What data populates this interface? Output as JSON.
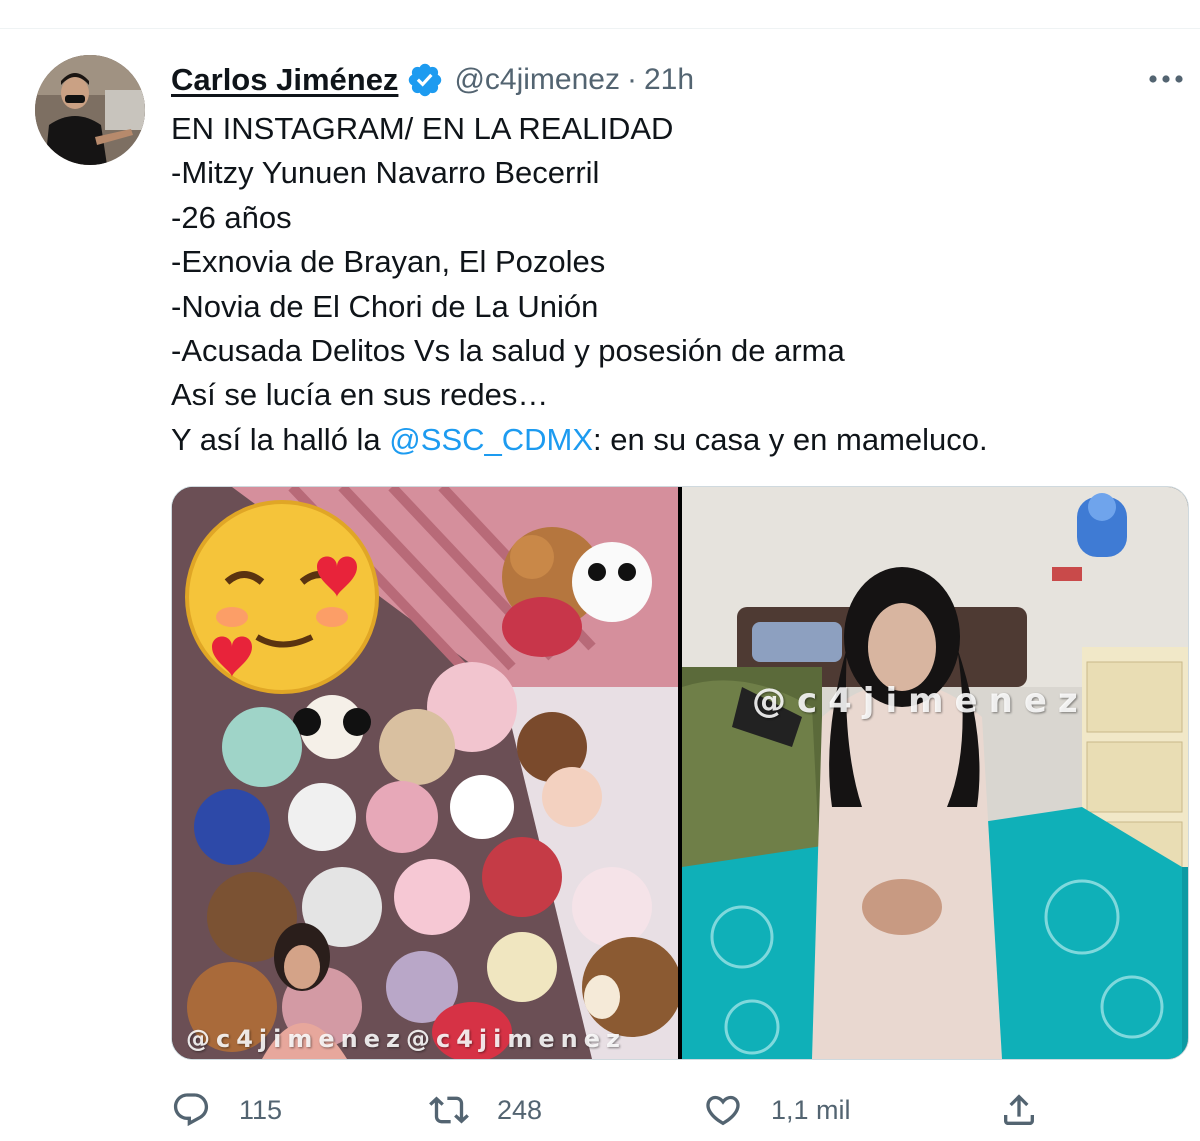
{
  "tweet": {
    "author": {
      "display_name": "Carlos Jiménez",
      "handle": "@c4jimenez",
      "verified": true,
      "avatar_icon": "avatar-photo"
    },
    "separator": "·",
    "time": "21h",
    "text_lines": [
      "EN INSTAGRAM/ EN LA REALIDAD",
      "-Mitzy Yunuen Navarro Becerril",
      "-26 años",
      "-Exnovia de Brayan, El Pozoles",
      "-Novia de El Chori de La Unión",
      "-Acusada Delitos Vs la salud y posesión de arma",
      "Así se lucía en sus redes…"
    ],
    "last_line": {
      "before": "Y así la halló la ",
      "mention": "@SSC_CDMX",
      "after": ":  en su casa y en mameluco."
    },
    "media": {
      "left_watermark": "@c4jimenez@c4jimenez",
      "right_watermark": "@c4jimenez"
    },
    "actions": {
      "replies": "115",
      "retweets": "248",
      "likes": "1,1 mil"
    }
  },
  "colors": {
    "text": "#0f1419",
    "secondary": "#536471",
    "accent": "#1d9bf0",
    "border": "#cfd9de"
  }
}
